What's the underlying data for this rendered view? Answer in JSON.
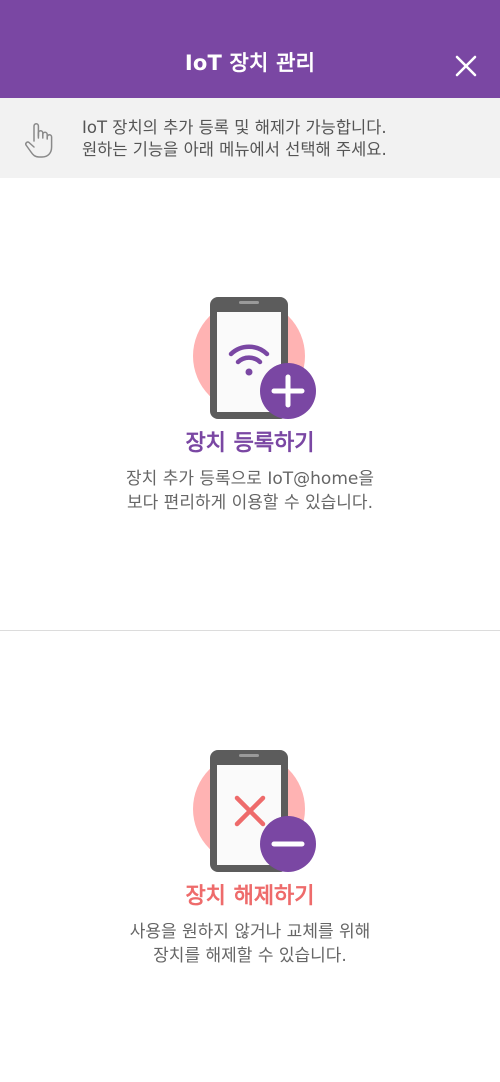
{
  "header": {
    "title": "IoT 장치 관리",
    "close_icon": "close-icon"
  },
  "info": {
    "icon": "hand-pointer-icon",
    "line1": "IoT 장치의 추가 등록 및 해제가 가능합니다.",
    "line2": "원하는 기능을 아래 메뉴에서 선택해 주세요."
  },
  "add_device": {
    "title": "장치 등록하기",
    "desc_line1": "장치 추가 등록으로 IoT@home을",
    "desc_line2": "보다 편리하게 이용할 수 있습니다.",
    "icon": "phone-wifi-add-icon"
  },
  "remove_device": {
    "title": "장치 해제하기",
    "desc_line1": "사용을 원하지 않거나 교체를 위해",
    "desc_line2": "장치를 해제할 수 있습니다.",
    "icon": "phone-remove-icon"
  },
  "colors": {
    "header_bg": "#7a47a3",
    "info_bg": "#f2f2f2",
    "add_accent": "#7a47a3",
    "remove_accent": "#ee6b6b",
    "circle_bg": "#ffb3b3",
    "phone_body": "#5c5c5c"
  }
}
